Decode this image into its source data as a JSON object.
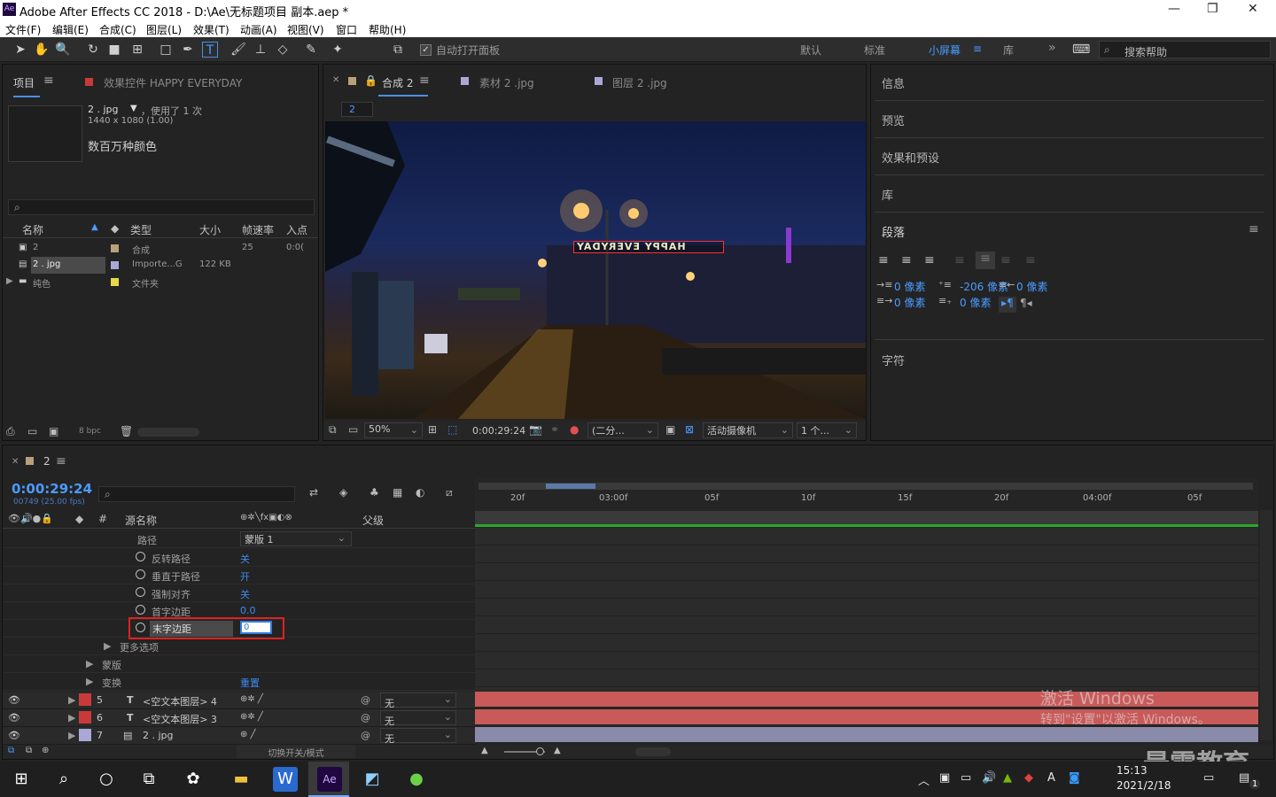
{
  "window": {
    "title": "Adobe After Effects CC 2018 - D:\\Ae\\无标题项目 副本.aep *",
    "logo": "Ae",
    "minimize": "—",
    "maximize": "❐",
    "close": "✕"
  },
  "menu": [
    "文件(F)",
    "编辑(E)",
    "合成(C)",
    "图层(L)",
    "效果(T)",
    "动画(A)",
    "视图(V)",
    "窗口",
    "帮助(H)"
  ],
  "toolbar": {
    "auto_open_label": "自动打开面板",
    "workspaces": [
      "默认",
      "标准",
      "小屏幕",
      "库"
    ],
    "active_workspace": "小屏幕",
    "search_placeholder": "搜索帮助"
  },
  "project": {
    "tab_project": "项目",
    "tab_effects": "效果控件 HAPPY EVERYDAY",
    "preview_name": "2 . jpg",
    "used_text": "，使用了 1 次",
    "dimensions": "1440 x 1080 (1.00)",
    "colors": "数百万种颜色",
    "search_placeholder": "",
    "columns": [
      "名称",
      "类型",
      "大小",
      "帧速率",
      "入点"
    ],
    "rows": [
      {
        "name": "2",
        "type": "合成",
        "size": "",
        "fps": "25",
        "in": "0:0(",
        "color": "#b8a07a"
      },
      {
        "name": "2 . jpg",
        "type": "Importe...G",
        "size": "122 KB",
        "fps": "",
        "in": "",
        "color": "#a9a8d6"
      },
      {
        "name": "纯色",
        "type": "文件夹",
        "size": "",
        "fps": "",
        "in": "",
        "color": "#e6d84a"
      }
    ],
    "bpc": "8 bpc"
  },
  "comp": {
    "tabs": [
      "合成 2",
      "素材 2 .jpg",
      "图层 2 .jpg"
    ],
    "sub_tab": "2",
    "overlay_text": "HAPPY EVERYDAY",
    "zoom": "50%",
    "timecode": "0:00:29:24",
    "resolution": "(二分...",
    "camera": "活动摄像机",
    "views": "1 个..."
  },
  "right": {
    "info": "信息",
    "preview": "预览",
    "effects": "效果和预设",
    "library": "库",
    "paragraph": "段落",
    "character": "字符",
    "indent_left": "0 像素",
    "indent_first": "0 像素",
    "space_before": "-206 像素",
    "space_after": "0 像素",
    "indent_right": "0 像素"
  },
  "timeline": {
    "comp_name": "2",
    "timecode": "0:00:29:24",
    "frame_info": "00749 (25.00 fps)",
    "col_source": "源名称",
    "col_parent": "父级",
    "properties": [
      {
        "label": "路径",
        "value": "蒙版 1",
        "type": "dropdown"
      },
      {
        "label": "反转路径",
        "value": "关"
      },
      {
        "label": "垂直于路径",
        "value": "开"
      },
      {
        "label": "强制对齐",
        "value": "关"
      },
      {
        "label": "首字边距",
        "value": "0.0"
      },
      {
        "label": "末字边距",
        "value": "0"
      }
    ],
    "more_options": "更多选项",
    "masks": "蒙版",
    "transform": "变换",
    "reset": "重置",
    "layers": [
      {
        "num": "5",
        "name": "<空文本图层> 4",
        "parent": "无",
        "color": "#c83a3a"
      },
      {
        "num": "6",
        "name": "<空文本图层> 3",
        "parent": "无",
        "color": "#c83a3a"
      },
      {
        "num": "7",
        "name": "2 . jpg",
        "parent": "无",
        "color": "#a9a8d6"
      }
    ],
    "ruler": [
      "20f",
      "03:00f",
      "05f",
      "10f",
      "15f",
      "20f",
      "04:00f",
      "05f"
    ],
    "toggle_label": "切换开关/模式",
    "watermark_title": "激活 Windows",
    "watermark_sub": "转到\"设置\"以激活 Windows。"
  },
  "taskbar": {
    "time": "15:13",
    "date": "2021/2/18",
    "ime": "A",
    "notif": "1"
  },
  "brand_watermark": "最需教育"
}
